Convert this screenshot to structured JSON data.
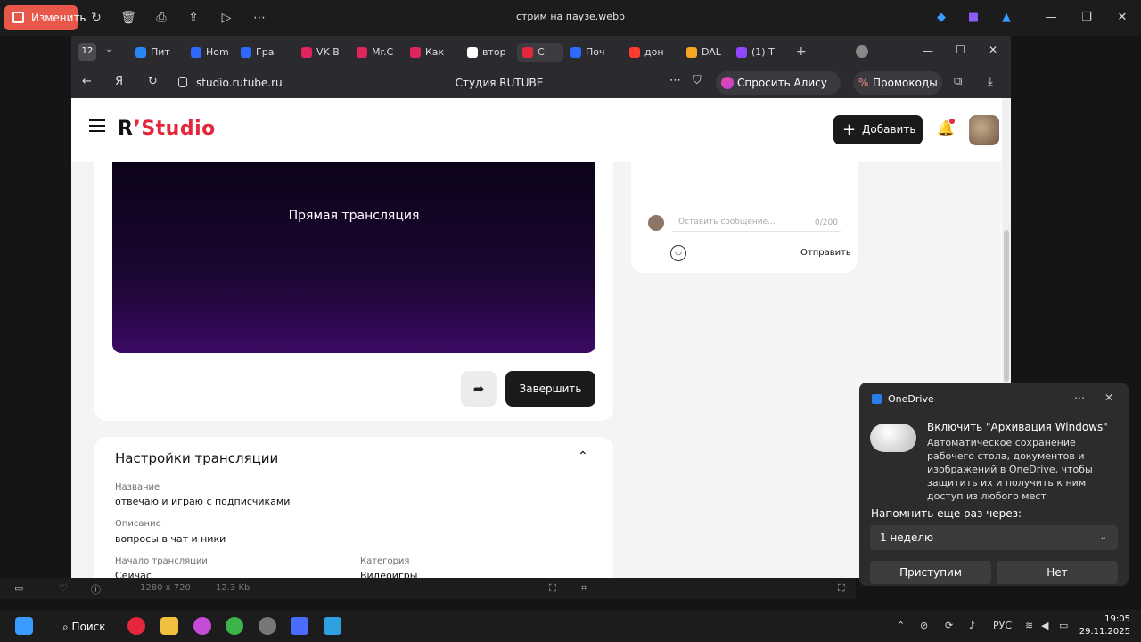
{
  "viewer": {
    "edit_label": "Изменить",
    "title": "стрим на паузе.webp",
    "status_dims": "1280 x 720",
    "status_size": "12.3 Kb"
  },
  "browser": {
    "tab_count": "12",
    "tabs": [
      {
        "label": "Пит",
        "color": "#2787f5"
      },
      {
        "label": "Hom",
        "color": "#2d6bff"
      },
      {
        "label": "Гра",
        "color": "#2d6bff"
      },
      {
        "label": "VK В",
        "color": "#e0245e"
      },
      {
        "label": "Mr.C",
        "color": "#e0245e"
      },
      {
        "label": "Как",
        "color": "#e0245e"
      },
      {
        "label": "втор",
        "color": "#ffffff"
      },
      {
        "label": "С",
        "color": "#e5263b"
      },
      {
        "label": "Поч",
        "color": "#2d6bff"
      },
      {
        "label": "дон",
        "color": "#ff3b30"
      },
      {
        "label": "DAL",
        "color": "#f5a623"
      },
      {
        "label": "(1) Т",
        "color": "#9146ff"
      }
    ],
    "url": "studio.rutube.ru",
    "page_title": "Студия RUTUBE",
    "alice_label": "Спросить Алису AI",
    "promo_label": "Промокоды"
  },
  "site": {
    "logo_r": "R",
    "logo_studio": "Studio",
    "add_label": "Добавить"
  },
  "player": {
    "live_title": "Прямая трансляция",
    "finish_label": "Завершить"
  },
  "chat": {
    "placeholder": "Оставить сообщение...",
    "counter": "0/200",
    "send_label": "Отправить"
  },
  "settings": {
    "title": "Настройки трансляции",
    "name_label": "Название",
    "name_value": "отвечаю и играю с подписчиками",
    "desc_label": "Описание",
    "desc_value": "вопросы в чат и ники",
    "start_label": "Начало трансляции",
    "start_value": "Сейчас",
    "category_label": "Категория",
    "category_value": "Видеоигры"
  },
  "onedrive": {
    "app": "OneDrive",
    "headline": "Включить \"Архивация Windows\"",
    "body": "Автоматическое сохранение рабочего стола, документов и изображений в OneDrive, чтобы защитить их и получить к ним доступ из любого мест",
    "remind_label": "Напомнить еще раз через:",
    "remind_value": "1 неделю",
    "accept_label": "Приступим",
    "decline_label": "Нет"
  },
  "taskbar": {
    "search_label": "Поиск",
    "lang": "РУС",
    "time": "19:05",
    "date": "29.11.2025"
  }
}
